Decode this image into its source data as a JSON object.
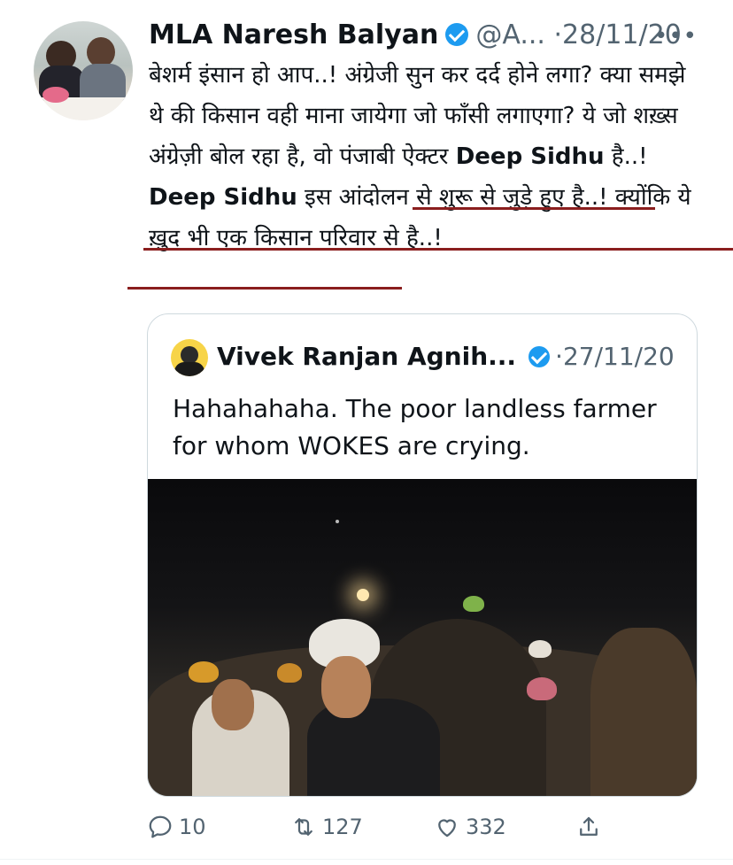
{
  "tweet": {
    "author_name": "MLA Naresh Balyan",
    "handle": "@A...",
    "separator": "·",
    "date": "28/11/20",
    "more_label": "•••",
    "text_part1": "बेशर्म इंसान हो आप..! अंग्रेजी सुन कर दर्द होने लगा? क्या समझे थे की किसान वही माना जायेगा जो फाँसी लगाएगा? ये जो शख़्स अंग्रेज़ी बोल रहा है, वो पंजाबी ऐक्टर ",
    "bold1": "Deep Sidhu",
    "text_part2": " है..! ",
    "bold2": "Deep Sidhu",
    "text_part3": " इस आंदोलन से शुरू से जुड़े हुए है..! क्योंकि ये ख़ुद भी एक किसान परिवार से है..!"
  },
  "quoted": {
    "author_name": "Vivek Ranjan Agnih...",
    "separator": "·",
    "date": "27/11/20",
    "text": "Hahahahaha. The poor landless farmer for whom WOKES are crying."
  },
  "actions": {
    "replies": "10",
    "retweets": "127",
    "likes": "332"
  },
  "icons": [
    "verified-icon",
    "more-icon",
    "reply-icon",
    "retweet-icon",
    "like-icon",
    "share-icon"
  ],
  "colors": {
    "verified": "#1d9bf0",
    "underline": "#8a1e1e",
    "muted": "#536471"
  }
}
